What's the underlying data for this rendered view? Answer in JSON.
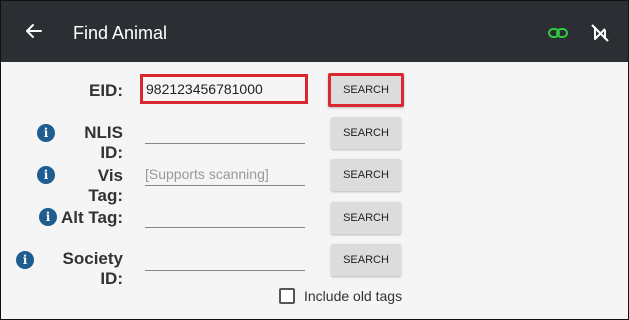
{
  "appbar": {
    "title": "Find Animal",
    "back_icon": "arrow-back-icon",
    "link_icon": "link-icon",
    "link_icon_color": "#2ecc40",
    "nfc_icon": "nfc-off-icon"
  },
  "form": {
    "eid": {
      "label": "EID:",
      "value": "982123456781000",
      "button": "SEARCH"
    },
    "nlis": {
      "label": "NLIS ID:",
      "value": "",
      "button": "SEARCH"
    },
    "vis": {
      "label": "Vis Tag:",
      "placeholder": "[Supports scanning]",
      "button": "SEARCH"
    },
    "alt": {
      "label": "Alt Tag:",
      "value": "",
      "button": "SEARCH"
    },
    "society": {
      "label": "Society ID:",
      "value": "",
      "button": "SEARCH"
    }
  },
  "options": {
    "include_old_tags_label": "Include old tags",
    "include_old_tags_checked": false
  },
  "colors": {
    "appbar": "#2b2f33",
    "highlight": "#d9282f",
    "info": "#1f5c8f"
  }
}
